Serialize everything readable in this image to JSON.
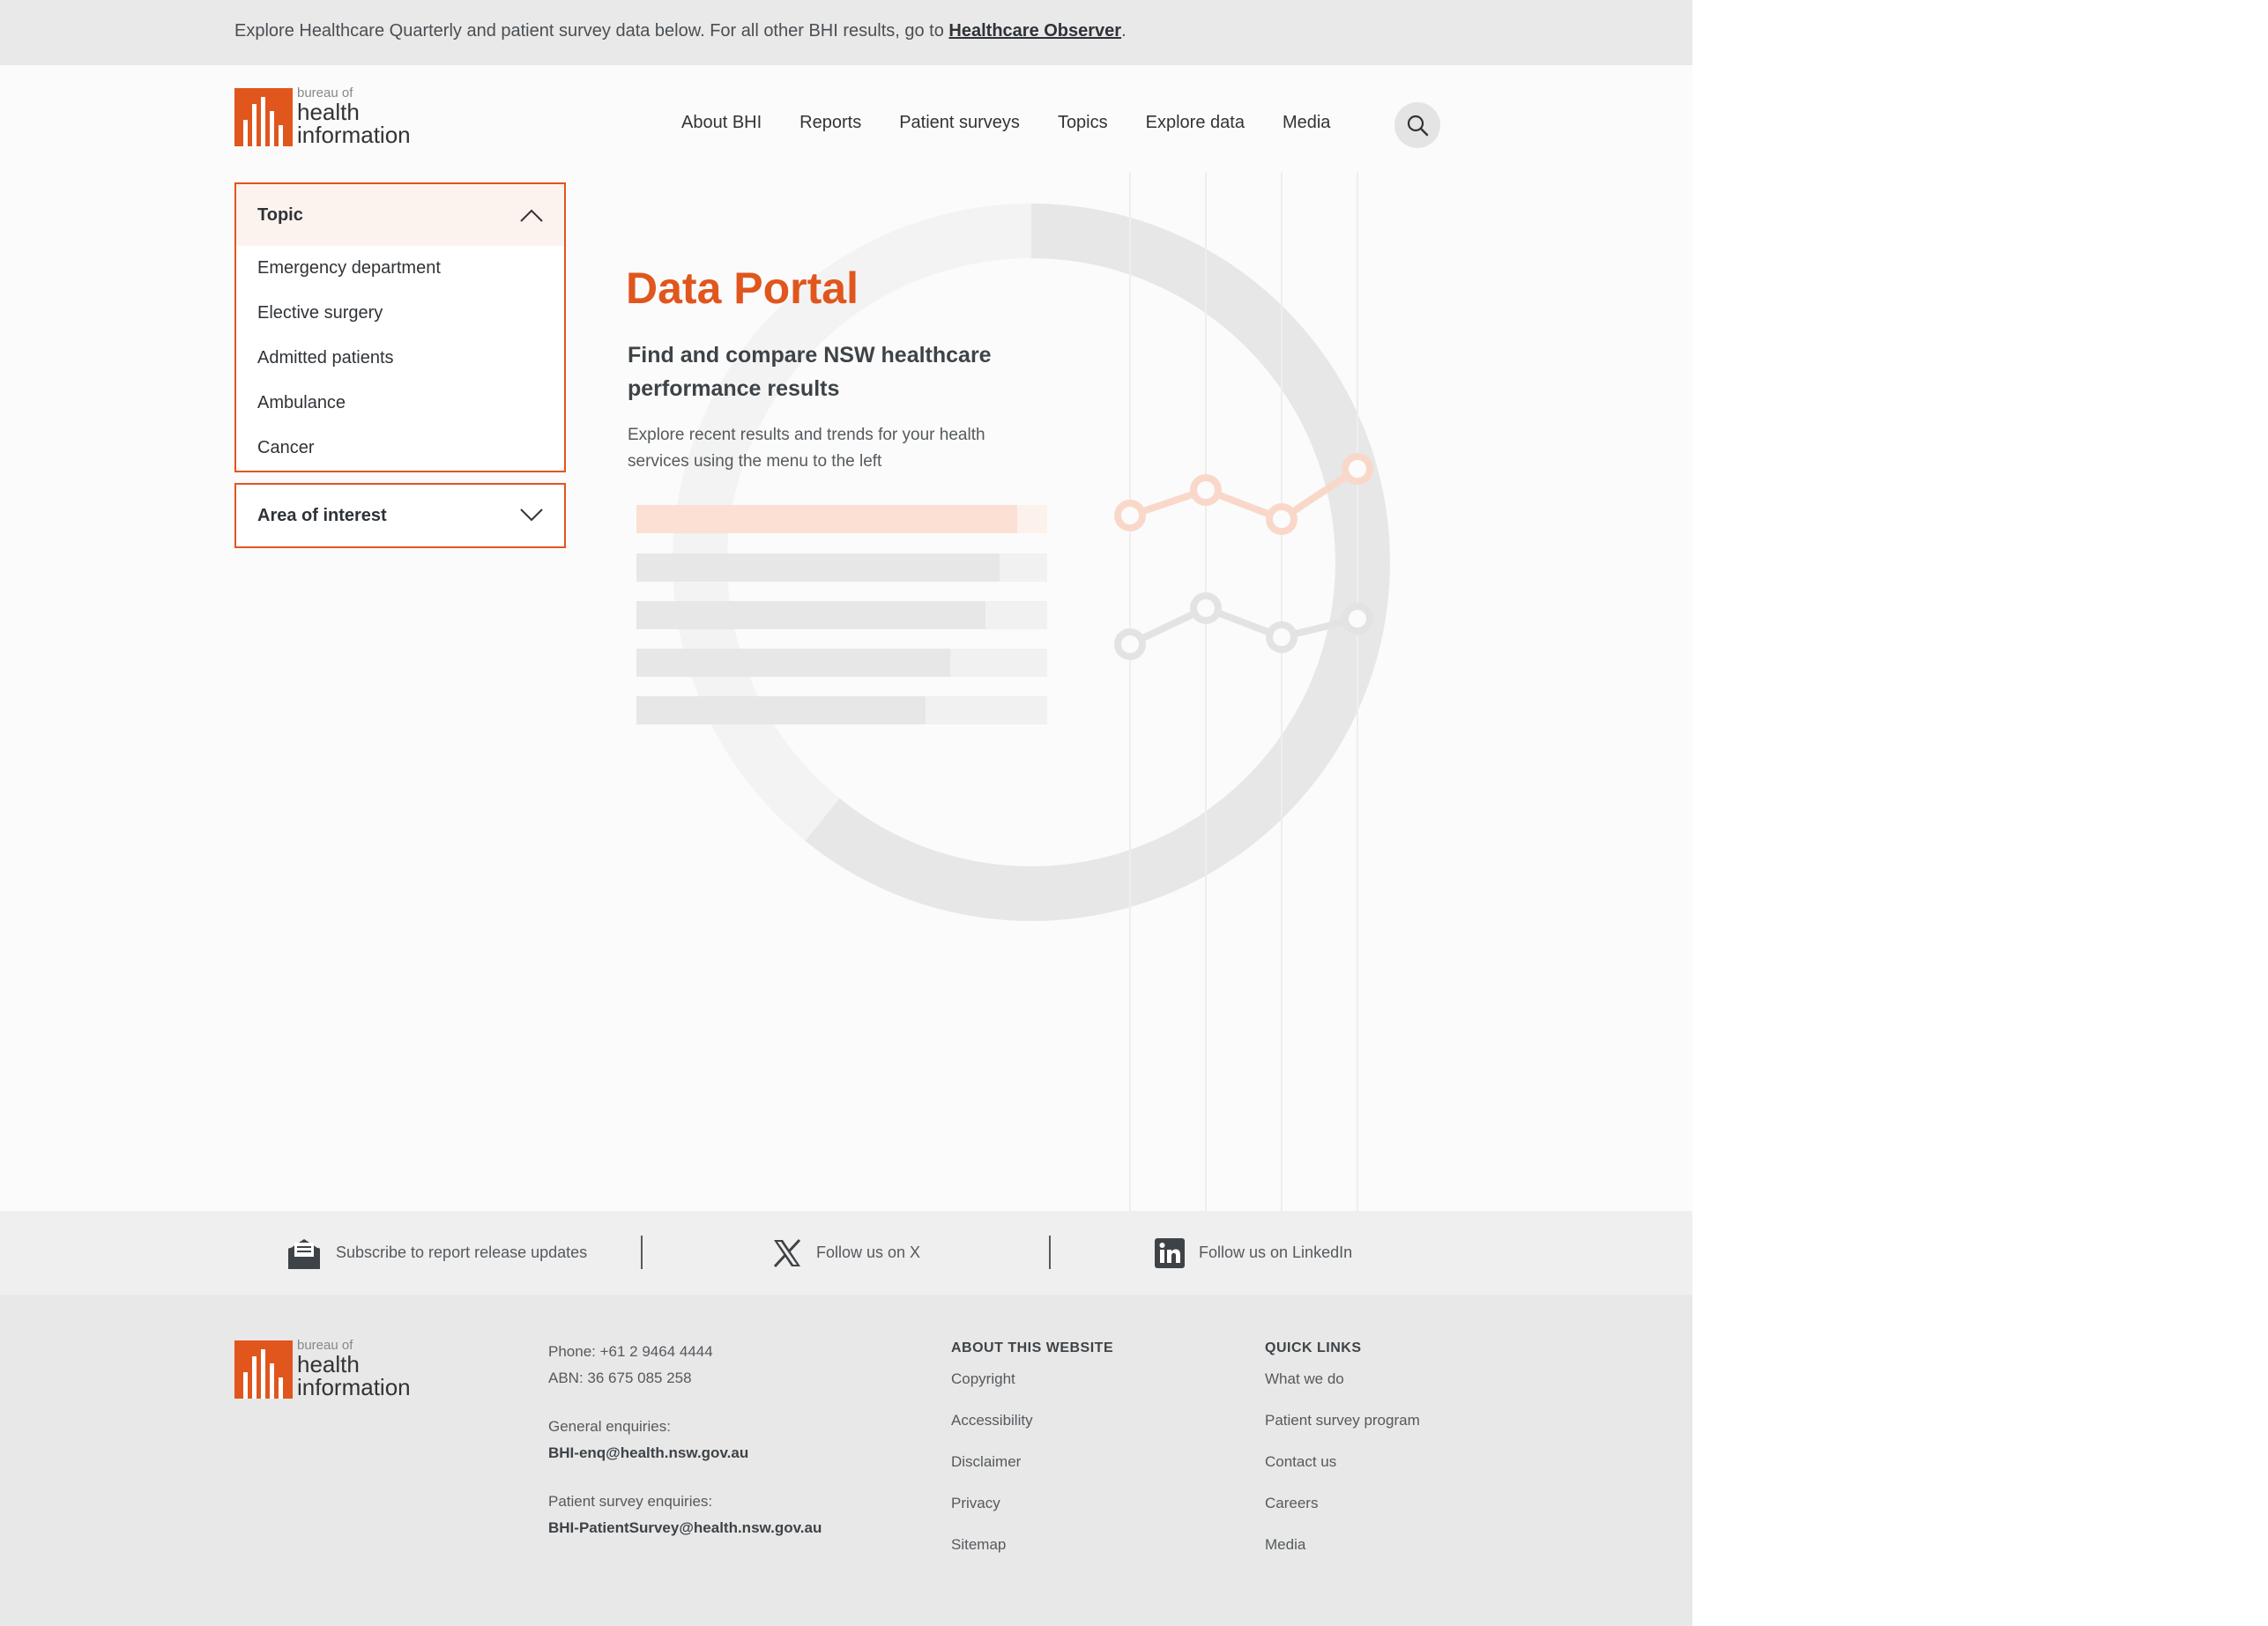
{
  "banner": {
    "text": "Explore Healthcare Quarterly and patient survey data below. For all other BHI results, go to ",
    "link": "Healthcare Observer",
    "end": "."
  },
  "logo": {
    "line1": "bureau of",
    "line2": "health",
    "line3": "information"
  },
  "nav": {
    "items": [
      "About BHI",
      "Reports",
      "Patient surveys",
      "Topics",
      "Explore data",
      "Media"
    ],
    "search_icon": "search-icon"
  },
  "sidebar": {
    "topic": {
      "label": "Topic",
      "items": [
        "Emergency department",
        "Elective surgery",
        "Admitted patients",
        "Ambulance",
        "Cancer"
      ]
    },
    "area": {
      "label": "Area of interest"
    }
  },
  "hero": {
    "title": "Data Portal",
    "subtitle": "Find and compare NSW healthcare performance results",
    "description": "Explore recent results and trends for your health services using the menu to the left"
  },
  "colors": {
    "accent": "#e0561d",
    "grey": "#e6e7e6"
  },
  "social": {
    "subscribe": "Subscribe to report release updates",
    "x": "Follow us on X",
    "linkedin": "Follow us on LinkedIn"
  },
  "footer": {
    "phone": "Phone: +61 2 9464 4444",
    "abn": "ABN: 36 675 085 258",
    "general_label": "General enquiries:",
    "general_email": "BHI-enq@health.nsw.gov.au",
    "survey_label": "Patient survey enquiries:",
    "survey_email": "BHI-PatientSurvey@health.nsw.gov.au",
    "about_heading": "ABOUT THIS WEBSITE",
    "about_links": [
      "Copyright",
      "Accessibility",
      "Disclaimer",
      "Privacy",
      "Sitemap"
    ],
    "quick_heading": "QUICK LINKS",
    "quick_links": [
      "What we do",
      "Patient survey program",
      "Contact us",
      "Careers",
      "Media"
    ]
  }
}
